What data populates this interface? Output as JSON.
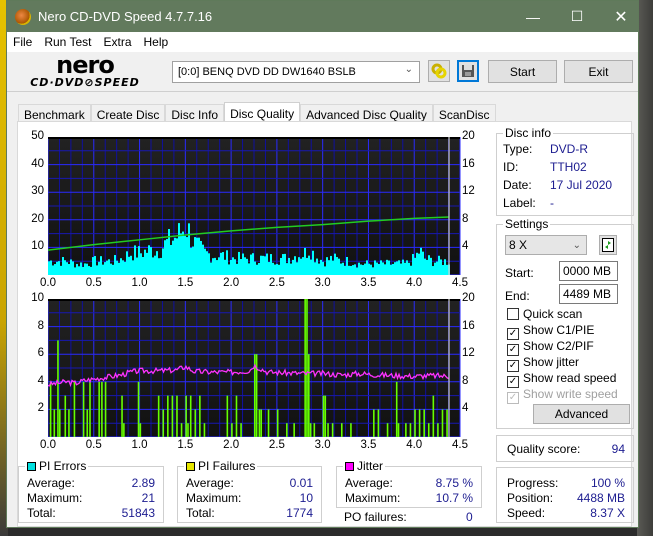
{
  "window": {
    "title": "Nero CD-DVD Speed 4.7.7.16"
  },
  "menu": [
    "File",
    "Run Test",
    "Extra",
    "Help"
  ],
  "toolbar": {
    "logo_top": "nero",
    "logo_bottom": "CD·DVD⊘SPEED",
    "drive": "[0:0]  BENQ DVD DD DW1640 BSLB",
    "start_label": "Start",
    "exit_label": "Exit"
  },
  "tabs": [
    "Benchmark",
    "Create Disc",
    "Disc Info",
    "Disc Quality",
    "Advanced Disc Quality",
    "ScanDisc"
  ],
  "active_tab": "Disc Quality",
  "disc_info": {
    "title": "Disc info",
    "rows": [
      {
        "label": "Type:",
        "value": "DVD-R"
      },
      {
        "label": "ID:",
        "value": "TTH02"
      },
      {
        "label": "Date:",
        "value": "17 Jul 2020"
      },
      {
        "label": "Label:",
        "value": "-"
      }
    ]
  },
  "settings": {
    "title": "Settings",
    "speed": "8 X",
    "start_label": "Start:",
    "start_value": "0000 MB",
    "end_label": "End:",
    "end_value": "4489 MB",
    "checkboxes": [
      {
        "label": "Quick scan",
        "checked": false,
        "enabled": true
      },
      {
        "label": "Show C1/PIE",
        "checked": true,
        "enabled": true
      },
      {
        "label": "Show C2/PIF",
        "checked": true,
        "enabled": true
      },
      {
        "label": "Show jitter",
        "checked": true,
        "enabled": true
      },
      {
        "label": "Show read speed",
        "checked": true,
        "enabled": true
      },
      {
        "label": "Show write speed",
        "checked": true,
        "enabled": false
      }
    ],
    "advanced_label": "Advanced"
  },
  "quality": {
    "label": "Quality score:",
    "value": "94"
  },
  "progress": {
    "rows": [
      {
        "label": "Progress:",
        "value": "100 %"
      },
      {
        "label": "Position:",
        "value": "4488 MB"
      },
      {
        "label": "Speed:",
        "value": "8.37 X"
      }
    ]
  },
  "stats": {
    "pi_errors": {
      "title": "PI Errors",
      "color": "#00e0e0",
      "average_label": "Average:",
      "average": "2.89",
      "maximum_label": "Maximum:",
      "maximum": "21",
      "total_label": "Total:",
      "total": "51843"
    },
    "pi_failures": {
      "title": "PI Failures",
      "color": "#e8e800",
      "average_label": "Average:",
      "average": "0.01",
      "maximum_label": "Maximum:",
      "maximum": "10",
      "total_label": "Total:",
      "total": "1774"
    },
    "jitter": {
      "title": "Jitter",
      "color": "#ff00ff",
      "average_label": "Average:",
      "average": "8.75 %",
      "maximum_label": "Maximum:",
      "maximum": "10.7 %"
    },
    "po_failures_label": "PO failures:",
    "po_failures": "0"
  },
  "chart_data": [
    {
      "type": "area",
      "title": "PI Errors / Read Speed",
      "x_ticks": [
        "0.0",
        "0.5",
        "1.0",
        "1.5",
        "2.0",
        "2.5",
        "3.0",
        "3.5",
        "4.0",
        "4.5"
      ],
      "y_left_ticks": [
        "50",
        "40",
        "30",
        "20",
        "10"
      ],
      "y_right_ticks": [
        "20",
        "16",
        "12",
        "8",
        "4"
      ],
      "xlim": [
        0,
        4.5
      ],
      "ylim_left": [
        0,
        50
      ],
      "ylim_right": [
        0,
        20
      ],
      "end_marker_x": 4.38,
      "series": [
        {
          "name": "PI Errors",
          "color": "#00ffff",
          "x": [
            0.0,
            0.1,
            0.2,
            0.3,
            0.4,
            0.5,
            0.6,
            0.7,
            0.8,
            0.9,
            1.0,
            1.1,
            1.2,
            1.3,
            1.4,
            1.45,
            1.5,
            1.55,
            1.6,
            1.7,
            1.8,
            1.9,
            2.0,
            2.1,
            2.2,
            2.3,
            2.4,
            2.5,
            2.6,
            2.7,
            2.8,
            2.85,
            2.9,
            3.0,
            3.1,
            3.2,
            3.3,
            3.4,
            3.5,
            3.6,
            3.7,
            3.8,
            3.9,
            4.0,
            4.05,
            4.1,
            4.2,
            4.3,
            4.38
          ],
          "values": [
            5,
            5,
            5,
            4,
            4,
            5,
            5,
            5,
            6,
            8,
            8,
            9,
            9,
            12,
            14,
            16,
            18,
            14,
            11,
            8,
            7,
            7,
            6,
            6,
            6,
            6,
            6,
            6,
            6,
            7,
            8,
            10,
            7,
            5,
            6,
            5,
            5,
            4,
            4,
            4,
            4,
            4,
            4,
            6,
            9,
            6,
            5,
            5,
            5
          ]
        },
        {
          "name": "Read Speed",
          "color": "#22cc22",
          "axis": "right",
          "x": [
            0.0,
            0.5,
            1.0,
            1.5,
            2.0,
            2.5,
            3.0,
            3.5,
            4.0,
            4.38
          ],
          "values": [
            3.6,
            4.4,
            5.1,
            5.8,
            6.4,
            6.9,
            7.3,
            7.8,
            8.2,
            8.4
          ]
        }
      ]
    },
    {
      "type": "bar",
      "title": "PI Failures / Jitter",
      "x_ticks": [
        "0.0",
        "0.5",
        "1.0",
        "1.5",
        "2.0",
        "2.5",
        "3.0",
        "3.5",
        "4.0",
        "4.5"
      ],
      "y_left_ticks": [
        "10",
        "8",
        "6",
        "4",
        "2"
      ],
      "y_right_ticks": [
        "20",
        "16",
        "12",
        "8",
        "4"
      ],
      "xlim": [
        0,
        4.5
      ],
      "ylim_left": [
        0,
        10
      ],
      "ylim_right": [
        0,
        20
      ],
      "end_marker_x": 4.38,
      "series": [
        {
          "name": "PI Failures",
          "color": "#66ff00",
          "x": [
            0.02,
            0.06,
            0.1,
            0.12,
            0.18,
            0.22,
            0.28,
            0.38,
            0.42,
            0.45,
            0.55,
            0.58,
            0.62,
            0.8,
            0.82,
            0.98,
            1.0,
            1.2,
            1.25,
            1.3,
            1.35,
            1.4,
            1.45,
            1.5,
            1.52,
            1.55,
            1.6,
            1.65,
            1.7,
            1.95,
            2.0,
            2.05,
            2.1,
            2.25,
            2.27,
            2.3,
            2.32,
            2.4,
            2.5,
            2.6,
            2.68,
            2.8,
            2.82,
            2.84,
            2.86,
            2.9,
            3.0,
            3.02,
            3.05,
            3.1,
            3.2,
            3.3,
            3.55,
            3.6,
            3.7,
            3.8,
            3.82,
            3.9,
            3.95,
            4.0,
            4.05,
            4.1,
            4.15,
            4.2,
            4.25,
            4.3,
            4.35
          ],
          "values": [
            4,
            2,
            7,
            2,
            3,
            2,
            4,
            4,
            2,
            4,
            4,
            4,
            4,
            3,
            1,
            4,
            1,
            3,
            2,
            3,
            3,
            3,
            1,
            3,
            1,
            3,
            2,
            3,
            1,
            3,
            1,
            3,
            1,
            6,
            6,
            2,
            2,
            2,
            2,
            1,
            1,
            10,
            10,
            6,
            1,
            1,
            3,
            3,
            1,
            1,
            1,
            1,
            2,
            2,
            1,
            4,
            1,
            1,
            1,
            2,
            2,
            2,
            1,
            3,
            1,
            2,
            2
          ]
        },
        {
          "name": "Jitter",
          "color": "#ff33ff",
          "axis": "right",
          "x": [
            0.0,
            0.1,
            0.2,
            0.3,
            0.4,
            0.5,
            0.6,
            0.7,
            0.8,
            0.9,
            1.0,
            1.2,
            1.4,
            1.5,
            1.6,
            1.8,
            2.0,
            2.2,
            2.25,
            2.4,
            2.6,
            2.8,
            3.0,
            3.2,
            3.4,
            3.6,
            3.8,
            4.0,
            4.2,
            4.38
          ],
          "values": [
            7.6,
            7.8,
            8.0,
            7.8,
            8.2,
            8.4,
            8.6,
            8.8,
            9.0,
            9.4,
            9.6,
            9.6,
            9.7,
            10.2,
            9.5,
            9.4,
            9.4,
            9.6,
            10.4,
            9.4,
            9.3,
            9.2,
            9.2,
            9.0,
            9.2,
            9.0,
            8.9,
            8.8,
            8.9,
            8.8
          ]
        }
      ]
    }
  ]
}
